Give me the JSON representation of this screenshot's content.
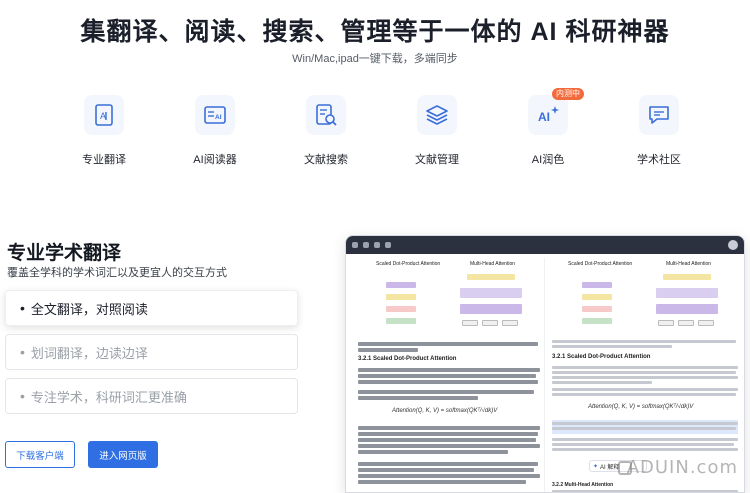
{
  "hero": {
    "title": "集翻译、阅读、搜索、管理等于一体的 AI 科研神器",
    "subtitle": "Win/Mac,ipad一键下载，多端同步"
  },
  "features": [
    {
      "label": "专业翻译",
      "icon": "document-a-icon"
    },
    {
      "label": "AI阅读器",
      "icon": "ai-reader-icon"
    },
    {
      "label": "文献搜索",
      "icon": "doc-search-icon"
    },
    {
      "label": "文献管理",
      "icon": "layers-icon"
    },
    {
      "label": "AI润色",
      "icon": "ai-sparkle-icon",
      "badge": "内测中"
    },
    {
      "label": "学术社区",
      "icon": "chat-bubble-icon"
    }
  ],
  "section": {
    "title": "专业学术翻译",
    "subtitle": "覆盖全学科的学术词汇以及更宜人的交互方式"
  },
  "options": [
    {
      "label": "全文翻译，对照阅读",
      "active": true
    },
    {
      "label": "划词翻译，边读边译",
      "active": false
    },
    {
      "label": "专注学术，科研词汇更准确",
      "active": false
    }
  ],
  "buttons": {
    "download": "下载客户端",
    "web": "进入网页版"
  },
  "preview": {
    "left_diagram_1": "Scaled Dot-Product Attention",
    "left_diagram_2": "Multi-Head Attention",
    "left_caption": "图2：（左）按比例缩放的点积注意力。（右）多头注意力由多个并行运行的注意力层组成。",
    "left_section": "3.2.1 Scaled Dot-Product Attention",
    "left_formula": "Attention(Q, K, V) = softmax(QKᵀ/√dk)V",
    "right_diagram_1": "Scaled Dot-Product Attention",
    "right_diagram_2": "Multi-Head Attention",
    "right_section": "3.2.1 Scaled Dot-Product Attention",
    "right_formula": "Attention(Q, K, V) = softmax(QKᵀ/√dk)V",
    "right_section_2": "3.2.2 Multi-Head Attention",
    "tip_label": "AI 解释",
    "watermark": "ADUIN.com"
  },
  "colors": {
    "accent": "#2f6fe3",
    "badge": "#f36a3b",
    "tile_bg": "#f3f6fc"
  }
}
